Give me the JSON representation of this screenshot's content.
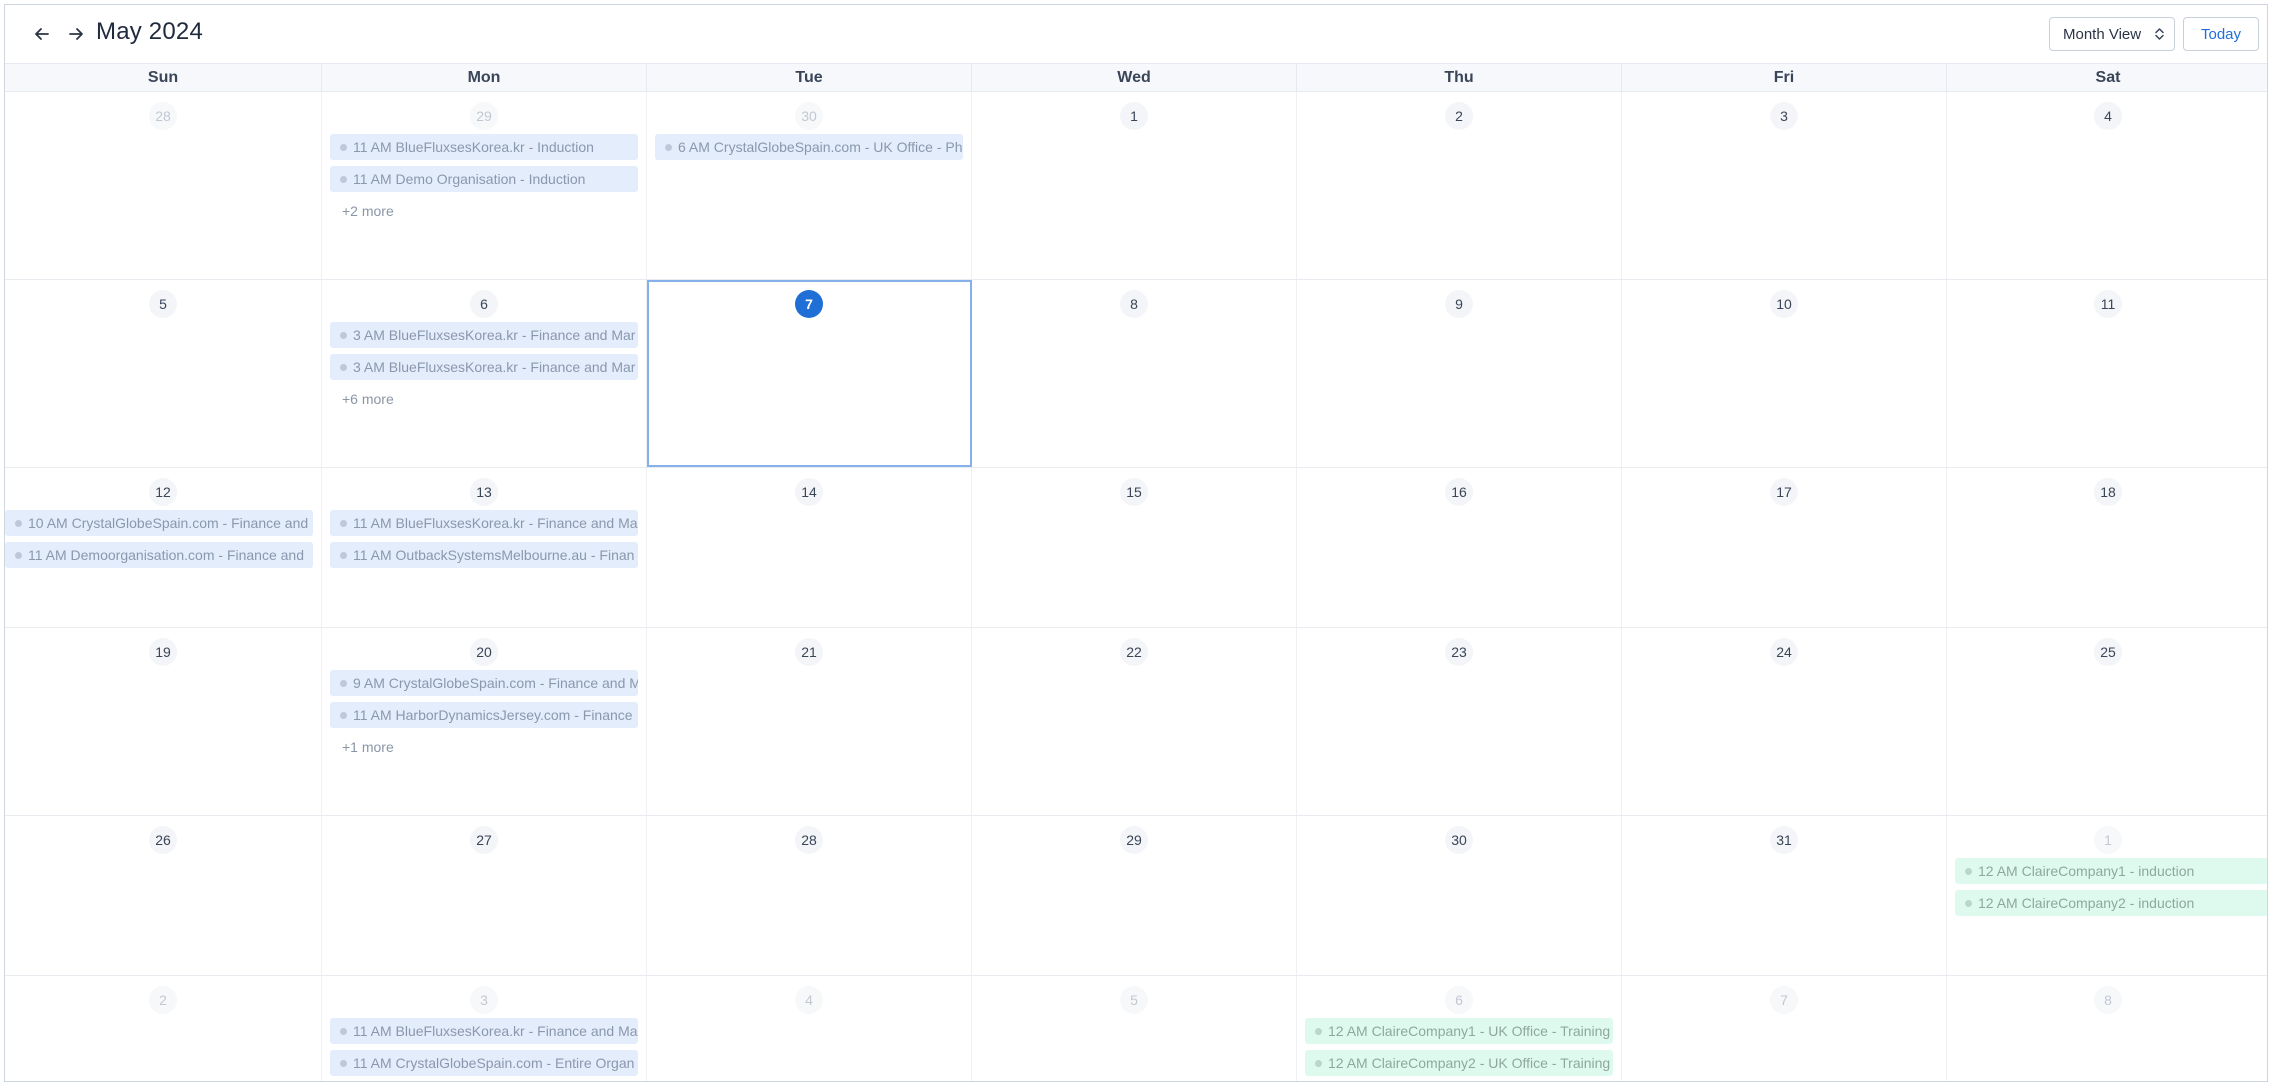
{
  "header": {
    "title": "May 2024",
    "view_label": "Month View",
    "today_label": "Today",
    "prev_icon": "arrow-left-icon",
    "next_icon": "arrow-right-icon"
  },
  "colors": {
    "accent": "#1f6fd6",
    "event_blue": "#e4edfb",
    "event_green": "#defaef"
  },
  "weekdays": [
    "Sun",
    "Mon",
    "Tue",
    "Wed",
    "Thu",
    "Fri",
    "Sat"
  ],
  "weeks": [
    {
      "days": [
        {
          "num": "28",
          "other": true,
          "events": []
        },
        {
          "num": "29",
          "other": true,
          "events": [
            "11 AM BlueFluxsesKorea.kr - Induction",
            "11 AM Demo Organisation - Induction"
          ],
          "more": "+2 more"
        },
        {
          "num": "30",
          "other": true,
          "events": [
            "6 AM CrystalGlobeSpain.com - UK Office - Ph"
          ]
        },
        {
          "num": "1",
          "events": []
        },
        {
          "num": "2",
          "events": []
        },
        {
          "num": "3",
          "events": []
        },
        {
          "num": "4",
          "events": []
        }
      ]
    },
    {
      "days": [
        {
          "num": "5",
          "events": []
        },
        {
          "num": "6",
          "events": [
            "3 AM BlueFluxsesKorea.kr - Finance and Mar",
            "3 AM BlueFluxsesKorea.kr - Finance and Mar"
          ],
          "more": "+6 more"
        },
        {
          "num": "7",
          "today": true,
          "events": []
        },
        {
          "num": "8",
          "events": []
        },
        {
          "num": "9",
          "events": []
        },
        {
          "num": "10",
          "events": []
        },
        {
          "num": "11",
          "events": []
        }
      ]
    },
    {
      "days": [
        {
          "num": "12",
          "events": [
            "10 AM CrystalGlobeSpain.com - Finance and",
            "11 AM Demoorganisation.com - Finance and"
          ],
          "edge_left": true
        },
        {
          "num": "13",
          "events": [
            "11 AM BlueFluxsesKorea.kr - Finance and Ma",
            "11 AM OutbackSystemsMelbourne.au - Finan"
          ]
        },
        {
          "num": "14",
          "events": []
        },
        {
          "num": "15",
          "events": []
        },
        {
          "num": "16",
          "events": []
        },
        {
          "num": "17",
          "events": []
        },
        {
          "num": "18",
          "events": []
        }
      ]
    },
    {
      "days": [
        {
          "num": "19",
          "events": []
        },
        {
          "num": "20",
          "events": [
            "9 AM CrystalGlobeSpain.com - Finance and M",
            "11 AM HarborDynamicsJersey.com - Finance"
          ],
          "more": "+1 more"
        },
        {
          "num": "21",
          "events": []
        },
        {
          "num": "22",
          "events": []
        },
        {
          "num": "23",
          "events": []
        },
        {
          "num": "24",
          "events": []
        },
        {
          "num": "25",
          "events": []
        }
      ]
    },
    {
      "days": [
        {
          "num": "26",
          "events": []
        },
        {
          "num": "27",
          "events": []
        },
        {
          "num": "28",
          "events": []
        },
        {
          "num": "29",
          "events": []
        },
        {
          "num": "30",
          "events": []
        },
        {
          "num": "31",
          "events": []
        },
        {
          "num": "1",
          "other": true,
          "green": true,
          "edge_right": true,
          "events": [
            "12 AM ClaireCompany1 - induction",
            "12 AM ClaireCompany2 - induction"
          ]
        }
      ]
    },
    {
      "days": [
        {
          "num": "2",
          "other": true,
          "events": []
        },
        {
          "num": "3",
          "other": true,
          "events": [
            "11 AM BlueFluxsesKorea.kr - Finance and Ma",
            "11 AM CrystalGlobeSpain.com - Entire Organ"
          ]
        },
        {
          "num": "4",
          "other": true,
          "events": []
        },
        {
          "num": "5",
          "other": true,
          "events": []
        },
        {
          "num": "6",
          "other": true,
          "green": true,
          "events": [
            "12 AM ClaireCompany1 - UK Office - Training",
            "12 AM ClaireCompany2 - UK Office - Training"
          ]
        },
        {
          "num": "7",
          "other": true,
          "events": []
        },
        {
          "num": "8",
          "other": true,
          "events": []
        }
      ]
    }
  ]
}
